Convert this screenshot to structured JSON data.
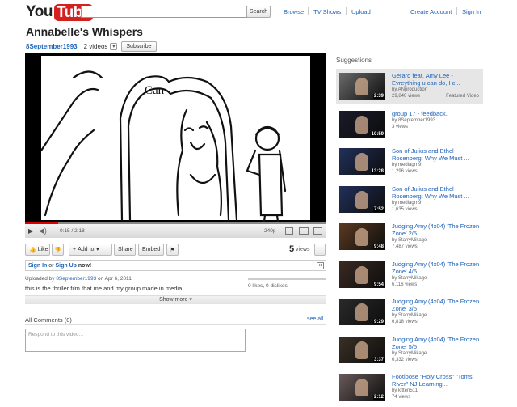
{
  "header": {
    "logo_you": "You",
    "logo_tube": "Tube",
    "search_button": "Search",
    "nav": [
      "Browse",
      "TV Shows",
      "Upload"
    ],
    "create_account": "Create Account",
    "sign_in": "Sign In"
  },
  "video": {
    "title": "Annabelle's Whispers",
    "uploader": "8September1993",
    "video_count": "2 videos",
    "subscribe": "Subscribe",
    "frame_caption": "Can",
    "time": "0:15 / 2:18",
    "progress": 0.11,
    "quality": "240p",
    "views_count": "5",
    "views_label": "views"
  },
  "actions": {
    "like": "Like",
    "add_to": "Add to",
    "share": "Share",
    "embed": "Embed"
  },
  "signin_notice": {
    "sign_in": "Sign In",
    "or": "or",
    "sign_up": "Sign Up",
    "now": "now!"
  },
  "details": {
    "uploaded_by": "Uploaded by",
    "uploader": "8September1993",
    "date": "on Apr 6, 2011",
    "description": "this is the thriller film that me and my group made in media.",
    "likes": "0 likes, 0 dislikes",
    "show_more": "Show more"
  },
  "comments": {
    "title": "All Comments (0)",
    "see_all": "see all",
    "placeholder": "Respond to this video..."
  },
  "suggestions": {
    "header": "Suggestions",
    "items": [
      {
        "title": "Gerard feat. Amy Lee - Evreything u can do, I c...",
        "by": "by ANproduction",
        "views": "29,840 views",
        "duration": "2:39",
        "tag": "Featured Video"
      },
      {
        "title": "group 17 - feedback.",
        "by": "by 8September1993",
        "views": "3 views",
        "duration": "10:59",
        "tag": ""
      },
      {
        "title": "Son of Julius and Ethel Rosenberg: Why We Must ...",
        "by": "by mediagrrl9",
        "views": "1,296 views",
        "duration": "13:28",
        "tag": ""
      },
      {
        "title": "Son of Julius and Ethel Rosenberg: Why We Must ...",
        "by": "by mediagrrl9",
        "views": "1,635 views",
        "duration": "7:52",
        "tag": ""
      },
      {
        "title": "Judging Amy (4x04) 'The Frozen Zone' 2/5",
        "by": "by StarryMikage",
        "views": "7,487 views",
        "duration": "9:48",
        "tag": ""
      },
      {
        "title": "Judging Amy (4x04) 'The Frozen Zone' 4/5",
        "by": "by StarryMikage",
        "views": "6,116 views",
        "duration": "9:54",
        "tag": ""
      },
      {
        "title": "Judging Amy (4x04) 'The Frozen Zone' 3/5",
        "by": "by StarryMikage",
        "views": "6,818 views",
        "duration": "9:29",
        "tag": ""
      },
      {
        "title": "Judging Amy (4x04) 'The Frozen Zone' 5/5",
        "by": "by StarryMikage",
        "views": "6,332 views",
        "duration": "3:37",
        "tag": ""
      },
      {
        "title": "Footloose \"Holy Cross\" \"Toms River\" NJ Learning...",
        "by": "by kitten511",
        "views": "74 views",
        "duration": "2:12",
        "tag": ""
      }
    ]
  }
}
